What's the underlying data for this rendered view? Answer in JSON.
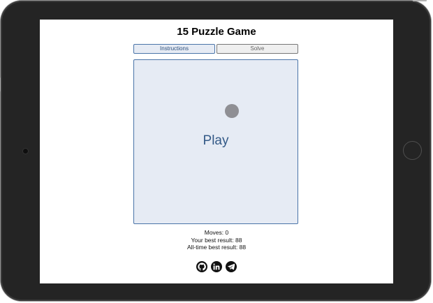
{
  "game": {
    "title": "15 Puzzle Game",
    "instructions_label": "Instructions",
    "solve_label": "Solve",
    "play_label": "Play"
  },
  "stats": {
    "moves": "Moves: 0",
    "best": "Your best result: 88",
    "alltime": "All-time best result: 88"
  },
  "social_icons": [
    "github-icon",
    "linkedin-icon",
    "telegram-icon"
  ],
  "colors": {
    "accent": "#4a74a8",
    "board_bg": "#e6ebf4",
    "play_text": "#345a87"
  }
}
